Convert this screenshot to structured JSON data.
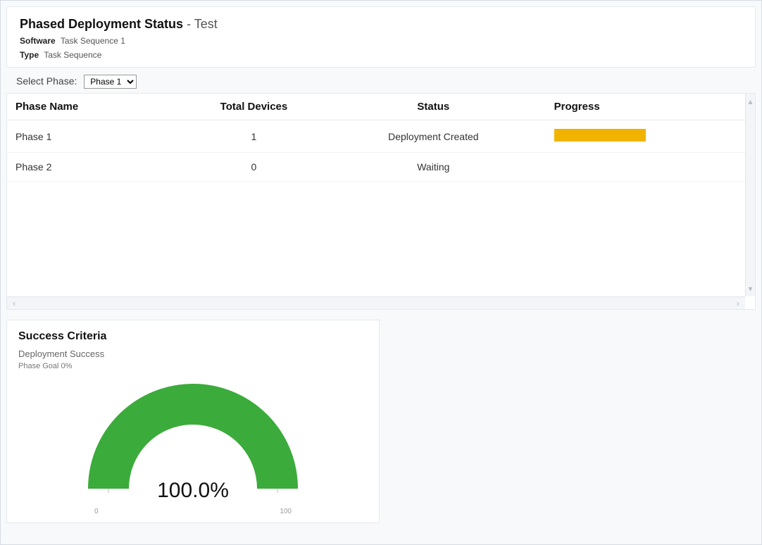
{
  "header": {
    "title": "Phased Deployment Status",
    "title_suffix": " - Test",
    "software_label": "Software",
    "software_value": "Task Sequence 1",
    "type_label": "Type",
    "type_value": "Task Sequence"
  },
  "phase_selector": {
    "label": "Select Phase:",
    "selected": "Phase 1",
    "options": [
      "Phase 1",
      "Phase 2"
    ]
  },
  "table": {
    "headers": {
      "name": "Phase Name",
      "devices": "Total Devices",
      "status": "Status",
      "progress": "Progress"
    },
    "rows": [
      {
        "name": "Phase 1",
        "devices": "1",
        "status": "Deployment Created",
        "progress_color": "#f0b400",
        "has_progress": true
      },
      {
        "name": "Phase 2",
        "devices": "0",
        "status": "Waiting",
        "progress_color": "",
        "has_progress": false
      }
    ]
  },
  "success": {
    "title": "Success Criteria",
    "subtitle": "Deployment Success",
    "goal": "Phase Goal 0%",
    "percent_label": "100.0%",
    "tick_min": "0",
    "tick_max": "100"
  },
  "chart_data": {
    "type": "pie",
    "title": "Success Criteria",
    "subtitle": "Deployment Success",
    "goal_label": "Phase Goal 0%",
    "value": 100.0,
    "min": 0,
    "max": 100,
    "unit": "%",
    "color": "#3bab3b"
  }
}
